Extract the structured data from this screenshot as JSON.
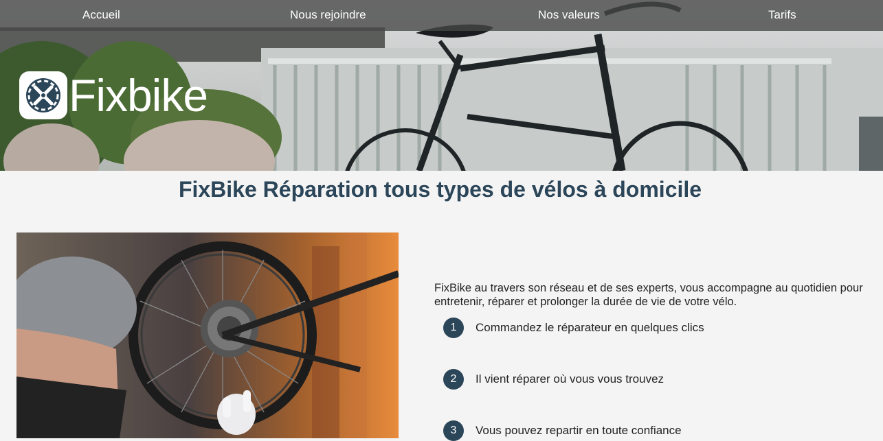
{
  "nav": {
    "items": [
      {
        "label": "Accueil"
      },
      {
        "label": "Nous rejoindre"
      },
      {
        "label": "Nos valeurs"
      },
      {
        "label": "Tarifs"
      }
    ]
  },
  "brand": {
    "name": "Fixbike",
    "icon": "wrench-gear-icon",
    "color": "#2b4559"
  },
  "hero": {
    "image": "bicycle-photo"
  },
  "main": {
    "title": "FixBike Réparation tous types de vélos à domicile",
    "photo": "mechanic-repairing-bike-photo",
    "intro": "FixBike au travers son réseau et de ses experts, vous accompagne au quotidien pour entretenir, réparer et prolonger la durée de vie de votre vélo.",
    "steps": [
      {
        "number": "1",
        "text": "Commandez le réparateur en quelques clics"
      },
      {
        "number": "2",
        "text": "Il vient réparer où vous vous trouvez"
      },
      {
        "number": "3",
        "text": "Vous pouvez repartir en toute confiance"
      }
    ]
  }
}
